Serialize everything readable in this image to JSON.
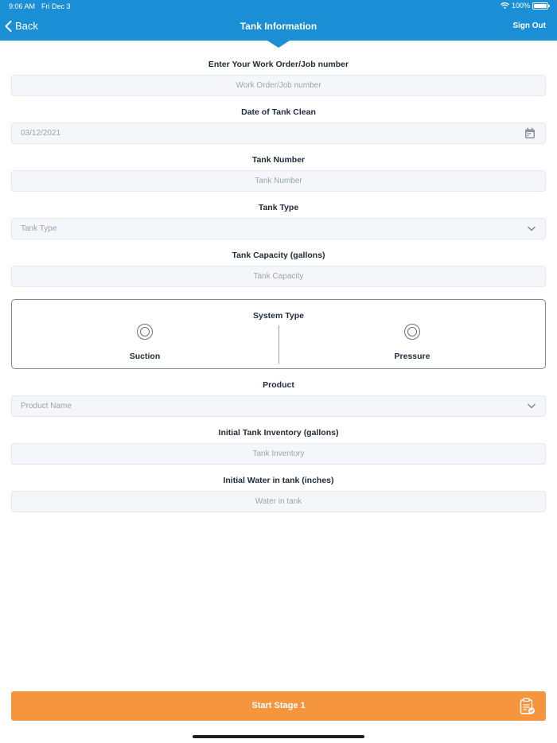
{
  "status_bar": {
    "time": "9:06 AM",
    "date": "Fri Dec 3",
    "battery": "100%",
    "wifi_icon": "wifi-icon",
    "battery_icon": "battery-icon"
  },
  "nav": {
    "back_label": "Back",
    "back_icon": "chevron-left-icon",
    "title": "Tank Information",
    "sign_out_label": "Sign Out"
  },
  "form": {
    "work_order": {
      "label": "Enter Your Work Order/Job number",
      "placeholder": "Work Order/Job number"
    },
    "date": {
      "label": "Date of Tank Clean",
      "value": "03/12/2021",
      "icon": "calendar-icon"
    },
    "tank_number": {
      "label": "Tank Number",
      "placeholder": "Tank Number"
    },
    "tank_type": {
      "label": "Tank Type",
      "placeholder": "Tank Type",
      "icon": "chevron-down-icon"
    },
    "tank_capacity": {
      "label": "Tank Capacity (gallons)",
      "placeholder": "Tank Capacity"
    },
    "system_type": {
      "label": "System Type",
      "options": [
        {
          "label": "Suction",
          "selected": false
        },
        {
          "label": "Pressure",
          "selected": false
        }
      ]
    },
    "product": {
      "label": "Product",
      "placeholder": "Product Name",
      "icon": "chevron-down-icon"
    },
    "initial_inventory": {
      "label": "Initial Tank Inventory (gallons)",
      "placeholder": "Tank Inventory"
    },
    "initial_water": {
      "label": "Initial Water in tank (inches)",
      "placeholder": "Water in tank"
    }
  },
  "footer": {
    "start_label": "Start Stage 1",
    "start_icon": "clipboard-check-icon"
  },
  "colors": {
    "header": "#1a8fd6",
    "button": "#f5953e",
    "field_bg": "#f4f6f9",
    "placeholder": "#9aa4b2"
  }
}
